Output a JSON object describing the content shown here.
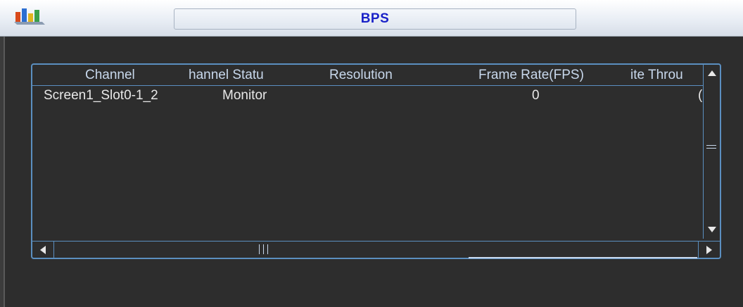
{
  "window": {
    "title": "BPS"
  },
  "table": {
    "columns": [
      "Channel",
      "hannel Statu",
      "Resolution",
      "Frame Rate(FPS)",
      "ite Throu"
    ],
    "rows": [
      {
        "channel": "Screen1_Slot0-1_2",
        "status": "Monitor",
        "resolution": "",
        "frame_rate": "0",
        "throughput": "("
      }
    ]
  },
  "icons": {
    "app": "chart-blocks-icon",
    "scroll_up": "triangle-up-icon",
    "scroll_down": "triangle-down-icon",
    "scroll_left": "triangle-left-icon",
    "scroll_right": "triangle-right-icon"
  },
  "colors": {
    "title_text": "#1a22c8",
    "frame_border": "#5b8fc0",
    "header_text": "#c8d8ec",
    "body_text": "#e8e8e8",
    "background": "#2d2d2d"
  }
}
